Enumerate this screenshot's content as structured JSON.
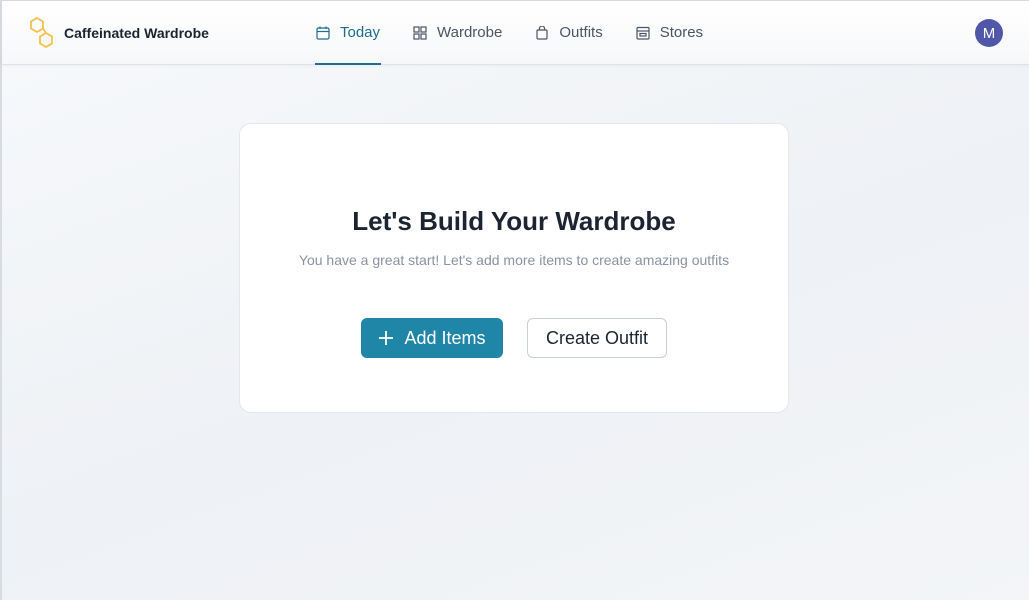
{
  "app": {
    "brand_name": "Caffeinated Wardrobe",
    "brand_color": "#f2c14e",
    "accent_color": "#1f6d8a"
  },
  "nav": {
    "items": [
      {
        "label": "Today",
        "icon": "calendar-icon",
        "active": true
      },
      {
        "label": "Wardrobe",
        "icon": "grid-icon",
        "active": false
      },
      {
        "label": "Outfits",
        "icon": "shopping-bag-icon",
        "active": false
      },
      {
        "label": "Stores",
        "icon": "store-icon",
        "active": false
      }
    ]
  },
  "user": {
    "avatar_initial": "M",
    "avatar_color": "#5157a8"
  },
  "hero": {
    "title": "Let's Build Your Wardrobe",
    "subtitle": "You have a great start! Let's add more items to create amazing outfits",
    "primary_button": {
      "label": "Add Items",
      "icon": "plus-icon",
      "color": "#1f86a8"
    },
    "secondary_button": {
      "label": "Create Outfit"
    }
  }
}
